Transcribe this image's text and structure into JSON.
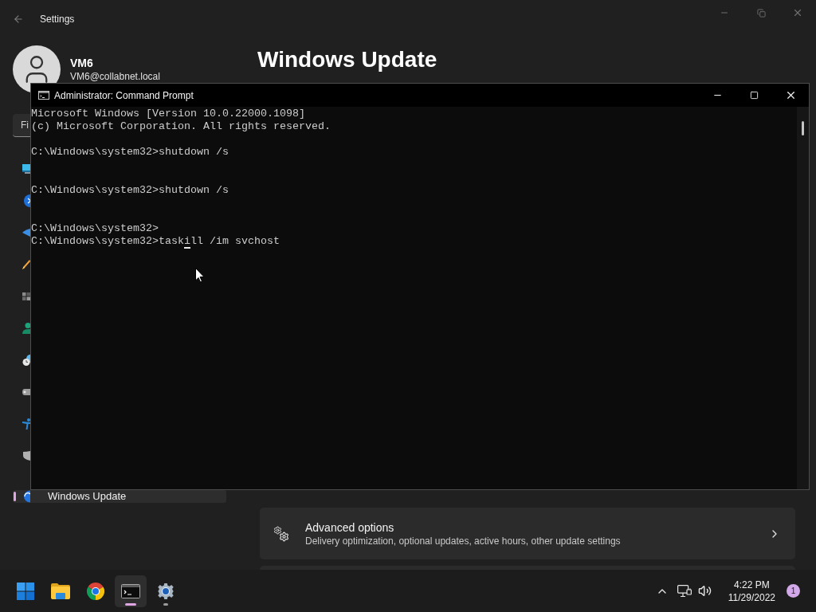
{
  "settings_window": {
    "title": "Settings",
    "account": {
      "name": "VM6",
      "email": "VM6@collabnet.local"
    },
    "page_title": "Windows Update",
    "sidebar": {
      "search": {
        "placeholder": "Fi"
      },
      "items": [
        {
          "selected": false
        },
        {
          "selected": false
        },
        {
          "selected": false
        },
        {
          "selected": false
        },
        {
          "selected": false
        },
        {
          "selected": false
        },
        {
          "selected": false
        },
        {
          "selected": false
        },
        {
          "selected": false
        },
        {
          "selected": false
        },
        {
          "label": "Windows Update",
          "selected": true
        }
      ]
    },
    "cards": [
      {
        "title": "Advanced options",
        "subtitle": "Delivery optimization, optional updates, active hours, other update settings"
      }
    ]
  },
  "console_window": {
    "title": "Administrator: Command Prompt",
    "lines": [
      {
        "kind": "text",
        "text": "Microsoft Windows [Version 10.0.22000.1098]"
      },
      {
        "kind": "text",
        "text": "(c) Microsoft Corporation. All rights reserved."
      },
      {
        "kind": "blank"
      },
      {
        "kind": "text",
        "text": "C:\\Windows\\system32>shutdown /s"
      },
      {
        "kind": "blank"
      },
      {
        "kind": "blank"
      },
      {
        "kind": "text",
        "text": "C:\\Windows\\system32>shutdown /s"
      },
      {
        "kind": "blank"
      },
      {
        "kind": "blank"
      },
      {
        "kind": "text",
        "text": "C:\\Windows\\system32>"
      }
    ],
    "input_line": {
      "prompt": "C:\\Windows\\system32>",
      "before_cursor": "task",
      "at_cursor": "i",
      "after_cursor": "ll /im svchost"
    }
  },
  "taskbar": {
    "apps": [
      {
        "running": false,
        "selected": false
      },
      {
        "running": false,
        "selected": false
      },
      {
        "running": true,
        "selected": true
      },
      {
        "running": true,
        "selected": false
      }
    ],
    "clock": {
      "time": "4:22 PM",
      "date": "11/29/2022"
    },
    "notification_count": "1"
  }
}
